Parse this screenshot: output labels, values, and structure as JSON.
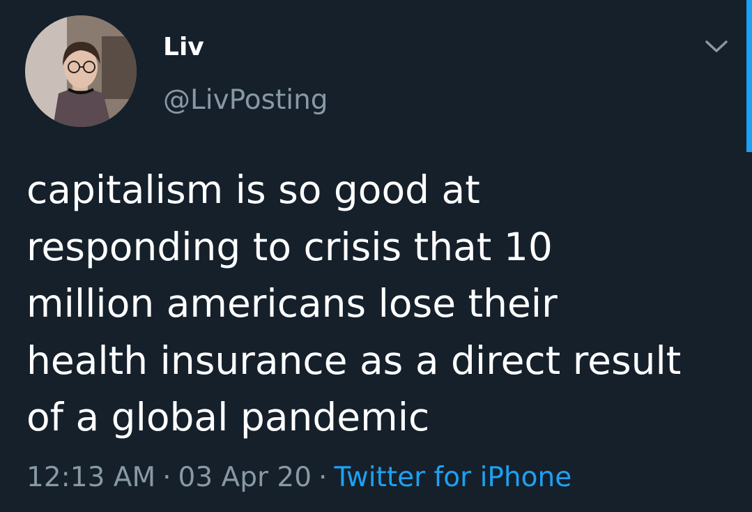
{
  "author": {
    "name": "Liv",
    "handle": "@LivPosting"
  },
  "tweet": {
    "lines": [
      "capitalism is so good at",
      "responding to crisis that 10",
      "million americans lose their",
      "health insurance as a direct result",
      "of a global pandemic"
    ]
  },
  "meta": {
    "time": "12:13 AM",
    "separator": "·",
    "date": "03 Apr 20",
    "source": "Twitter for iPhone"
  },
  "icons": {
    "menu": "chevron-down-icon"
  },
  "colors": {
    "background": "#15202b",
    "text": "#ffffff",
    "secondary": "#8899a6",
    "accent": "#1da1f2"
  }
}
